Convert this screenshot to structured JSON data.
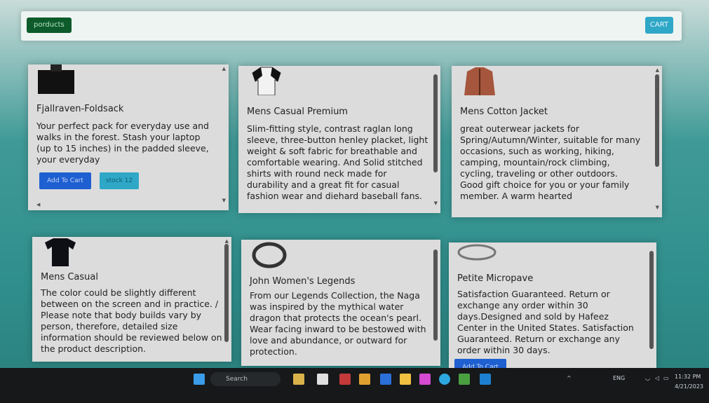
{
  "navbar": {
    "brand": "porducts",
    "cart": "CART"
  },
  "products": [
    {
      "title": "Fjallraven-Foldsack",
      "description": "Your perfect pack for everyday use and walks in the forest. Stash your laptop (up to 15 inches) in the padded sleeve, your everyday",
      "add_to_cart": "Add To Cart",
      "stock": "stock 12",
      "image_icon": "backpack-icon"
    },
    {
      "title": "Mens Casual Premium",
      "description": "Slim-fitting style, contrast raglan long sleeve, three-button henley placket, light weight & soft fabric for breathable and comfortable wearing. And Solid stitched shirts with round neck made for durability and a great fit for casual fashion wear and diehard baseball fans.",
      "image_icon": "raglan-shirt-icon"
    },
    {
      "title": "Mens Cotton Jacket",
      "description": "great outerwear jackets for Spring/Autumn/Winter, suitable for many occasions, such as working, hiking, camping, mountain/rock climbing, cycling, traveling or other outdoors. Good gift choice for you or your family member. A warm hearted",
      "image_icon": "jacket-icon"
    },
    {
      "title": "Mens Casual",
      "description": "The color could be slightly different between on the screen and in practice. / Please note that body builds vary by person, therefore, detailed size information should be reviewed below on the product description.",
      "image_icon": "tshirt-icon"
    },
    {
      "title": "John Women's Legends",
      "description": "From our Legends Collection, the Naga was inspired by the mythical water dragon that protects the ocean's pearl. Wear facing inward to be bestowed with love and abundance, or outward for protection.",
      "image_icon": "bracelet-icon"
    },
    {
      "title": "Petite Micropave",
      "description": "Satisfaction Guaranteed. Return or exchange any order within 30 days.Designed and sold by Hafeez Center in the United States. Satisfaction Guaranteed. Return or exchange any order within 30 days.",
      "add_to_cart": "Add To Cart",
      "image_icon": "ring-icon"
    }
  ],
  "taskbar": {
    "search_label": "Search",
    "tray_lang": "ENG",
    "time": "11:32 PM",
    "date": "4/21/2023"
  }
}
